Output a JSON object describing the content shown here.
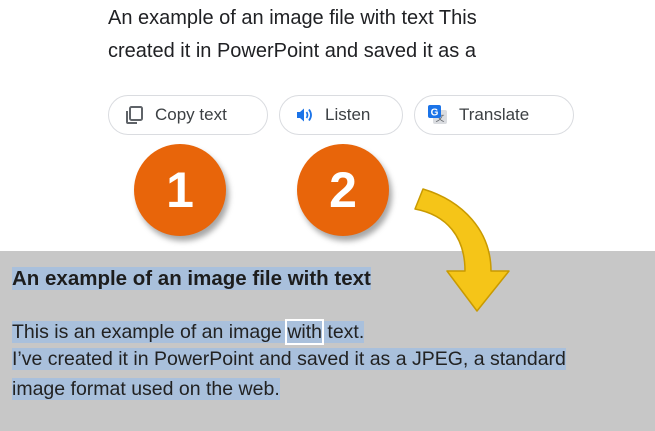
{
  "result_text": {
    "line1": "An example of an image file with text This",
    "line2": "created it in PowerPoint and saved it as a"
  },
  "actions": {
    "copy_text": "Copy text",
    "listen": "Listen",
    "translate": "Translate"
  },
  "badges": {
    "one": "1",
    "two": "2"
  },
  "document": {
    "title": "An example of an image file with text",
    "line1_pre": "This is an example of an image ",
    "line1_word": "with",
    "line1_post": " text.",
    "line2": "I’ve created it in PowerPoint and saved it as a JPEG, a standard",
    "line3": "image format used on the web."
  },
  "colors": {
    "badge": "#e8650a",
    "arrow": "#f5c518",
    "highlight": "#a9c0dc",
    "doc_background": "#c7c7c7"
  }
}
